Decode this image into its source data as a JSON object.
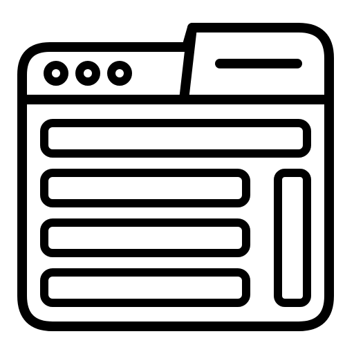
{
  "icon": {
    "name": "browser-window-layout-icon",
    "stroke_color": "#000000",
    "background_color": "#ffffff",
    "style": "line-icon",
    "tab_count": 1,
    "window_control_dots": 3,
    "content_bars": 4,
    "sidebar_panels": 1
  }
}
